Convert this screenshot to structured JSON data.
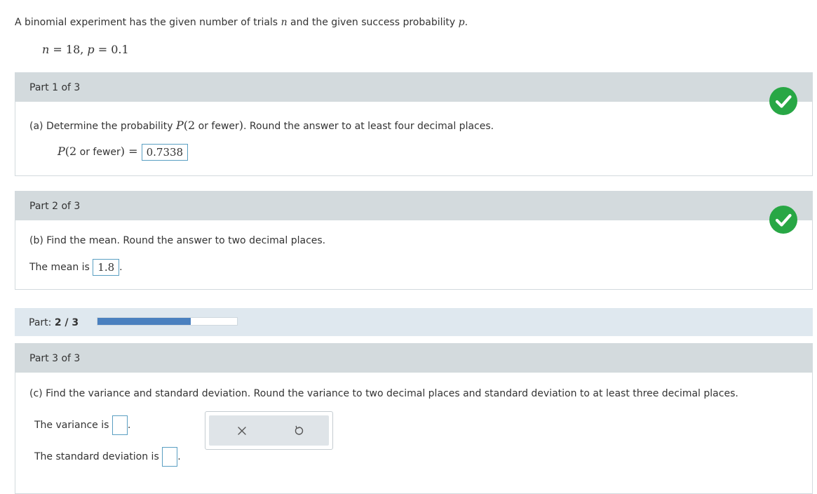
{
  "intro": {
    "text_before": "A binomial experiment has the given number of trials ",
    "var_n": "n",
    "text_middle": " and the given success probability ",
    "var_p": "p",
    "text_end": "."
  },
  "given": {
    "n_var": "n",
    "n_eq": " = 18, ",
    "p_var": "p",
    "p_eq": " = 0.1"
  },
  "parts": [
    {
      "header": "Part 1 of 3",
      "q_prefix": "(a) Determine the probability ",
      "q_P": "P",
      "q_open": "(2",
      "q_inner": " or fewer",
      "q_close": ")",
      "q_suffix": ". Round the answer to at least four decimal places.",
      "ans_P": "P",
      "ans_open": "(2",
      "ans_inner": " or fewer",
      "ans_close": ")",
      "ans_eq": " = ",
      "answer": "0.7338",
      "status": "correct"
    },
    {
      "header": "Part 2 of 3",
      "question": "(b) Find the mean. Round the answer to two decimal places.",
      "ans_prefix": "The mean is ",
      "answer": "1.8",
      "ans_suffix": ".",
      "status": "correct"
    },
    {
      "header": "Part 3 of 3",
      "question": "(c) Find the variance and standard deviation. Round the variance to two decimal places and standard deviation to at least three decimal places.",
      "variance_label": "The variance is ",
      "variance_value": "",
      "variance_suffix": ".",
      "sd_label": "The standard deviation is ",
      "sd_value": "",
      "sd_suffix": "."
    }
  ],
  "progress": {
    "label": "Part: ",
    "current_total": "2 / 3",
    "fraction": 0.667,
    "fill_color": "#4a80bf"
  },
  "toolbar": {
    "clear_icon": "x-icon",
    "undo_icon": "undo-icon"
  },
  "colors": {
    "correct": "#28a745",
    "header_bg": "#d3dadd",
    "progress_bg": "#dfe8ef"
  }
}
